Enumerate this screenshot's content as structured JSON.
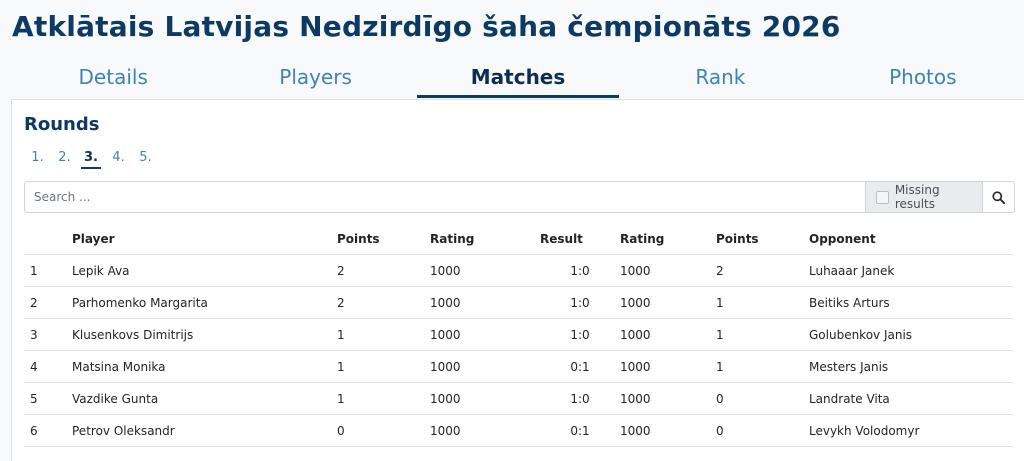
{
  "title": "Atklātais Latvijas Nedzirdīgo šaha čempionāts 2026",
  "tabs": [
    "Details",
    "Players",
    "Matches",
    "Rank",
    "Photos"
  ],
  "active_tab": "Matches",
  "rounds": {
    "title": "Rounds",
    "items": [
      "1.",
      "2.",
      "3.",
      "4.",
      "5."
    ],
    "active": "3."
  },
  "search": {
    "placeholder": "Search ...",
    "missing_results_label": "Missing results",
    "button_icon": "search-icon"
  },
  "colors": {
    "title": "#0d3a63",
    "link": "#3d84b5",
    "active_tab": "#0d2e52"
  },
  "table": {
    "headers": [
      "",
      "Player",
      "Points",
      "Rating",
      "Result",
      "Rating",
      "Points",
      "Opponent"
    ],
    "rows": [
      [
        "1",
        "Lepik Ava",
        "2",
        "1000",
        "1:0",
        "1000",
        "2",
        "Luhaaar Janek"
      ],
      [
        "2",
        "Parhomenko Margarita",
        "2",
        "1000",
        "1:0",
        "1000",
        "1",
        "Beitiks Arturs"
      ],
      [
        "3",
        "Klusenkovs Dimitrijs",
        "1",
        "1000",
        "1:0",
        "1000",
        "1",
        "Golubenkov Janis"
      ],
      [
        "4",
        "Matsina Monika",
        "1",
        "1000",
        "0:1",
        "1000",
        "1",
        "Mesters Janis"
      ],
      [
        "5",
        "Vazdike Gunta",
        "1",
        "1000",
        "1:0",
        "1000",
        "0",
        "Landrate Vita"
      ],
      [
        "6",
        "Petrov Oleksandr",
        "0",
        "1000",
        "0:1",
        "1000",
        "0",
        "Levykh Volodomyr"
      ]
    ]
  }
}
